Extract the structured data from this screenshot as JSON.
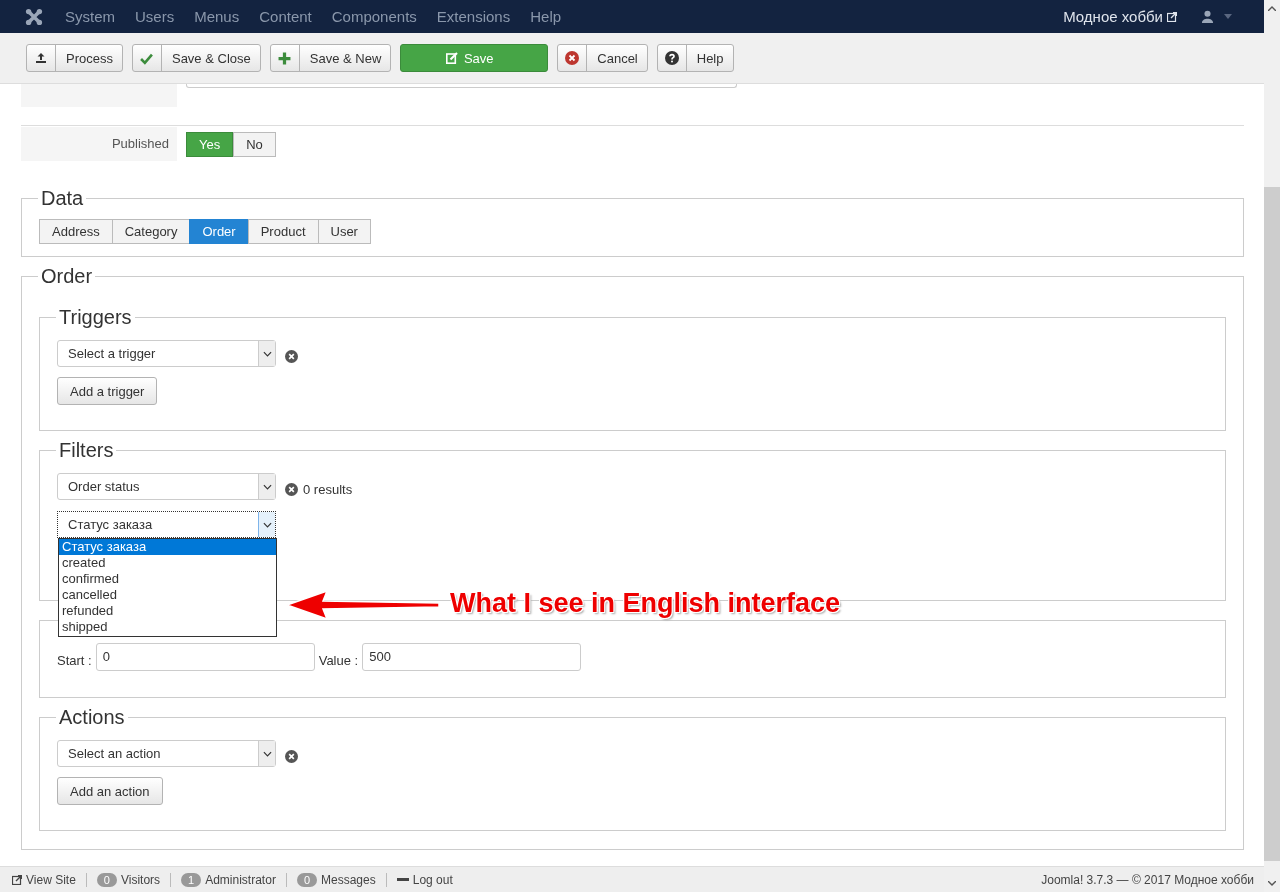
{
  "nav": {
    "menu": [
      "System",
      "Users",
      "Menus",
      "Content",
      "Components",
      "Extensions",
      "Help"
    ],
    "site_link": "Модное хобби"
  },
  "toolbar": [
    {
      "label": "Process",
      "kind": "upload",
      "primary": false
    },
    {
      "label": "Save & Close",
      "kind": "check",
      "primary": false
    },
    {
      "label": "Save & New",
      "kind": "plus",
      "primary": false
    },
    {
      "label": "Save",
      "kind": "edit",
      "primary": true
    },
    {
      "label": "Cancel",
      "kind": "cancel",
      "primary": false
    },
    {
      "label": "Help",
      "kind": "help",
      "primary": false
    }
  ],
  "published": {
    "label": "Published",
    "options": [
      {
        "label": "Yes",
        "selected": true
      },
      {
        "label": "No",
        "selected": false
      }
    ]
  },
  "data": {
    "legend": "Data",
    "tabs": [
      {
        "label": "Address",
        "selected": false
      },
      {
        "label": "Category",
        "selected": false
      },
      {
        "label": "Order",
        "selected": true
      },
      {
        "label": "Product",
        "selected": false
      },
      {
        "label": "User",
        "selected": false
      }
    ]
  },
  "order": {
    "legend": "Order",
    "triggers": {
      "legend": "Triggers",
      "select": "Select a trigger",
      "button": "Add a trigger"
    },
    "filters": {
      "legend": "Filters",
      "select": "Order status",
      "results": "0 results",
      "status_select": "Статус заказа",
      "options": [
        {
          "label": "Статус заказа",
          "selected": true
        },
        {
          "label": "created",
          "selected": false
        },
        {
          "label": "confirmed",
          "selected": false
        },
        {
          "label": "cancelled",
          "selected": false
        },
        {
          "label": "refunded",
          "selected": false
        },
        {
          "label": "shipped",
          "selected": false
        }
      ]
    },
    "range": {
      "start_label": "Start :",
      "start": "0",
      "value_label": "Value :",
      "value": "500"
    },
    "actions": {
      "legend": "Actions",
      "select": "Select an action",
      "button": "Add an action"
    }
  },
  "annotation": {
    "text": "What I see in English interface"
  },
  "footer": {
    "items": [
      {
        "kind": "link",
        "label": "View Site"
      },
      {
        "kind": "badge",
        "count": "0",
        "label": "Visitors"
      },
      {
        "kind": "badge",
        "count": "1",
        "label": "Administrator"
      },
      {
        "kind": "badge",
        "count": "0",
        "label": "Messages"
      },
      {
        "kind": "logout",
        "label": "Log out"
      }
    ],
    "version": "Joomla! 3.7.3 — © 2017 Модное хобби"
  }
}
